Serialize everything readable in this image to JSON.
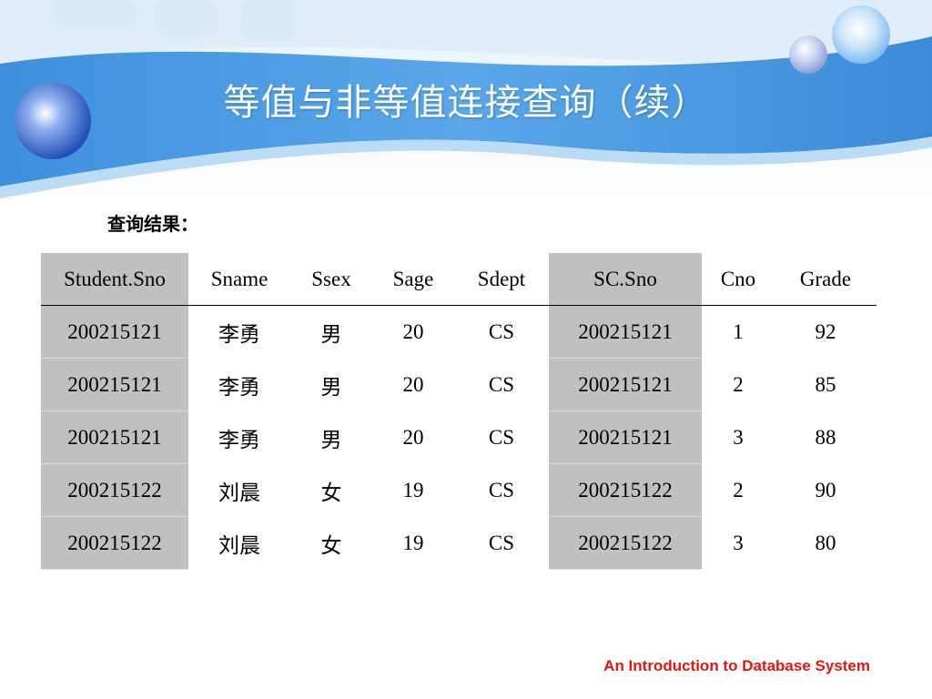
{
  "slide": {
    "title": "等值与非等值连接查询（续）",
    "label": "查询结果：",
    "footer": "An Introduction to Database System"
  },
  "table": {
    "headers": [
      "Student.Sno",
      "Sname",
      "Ssex",
      "Sage",
      "Sdept",
      "SC.Sno",
      "Cno",
      "Grade"
    ],
    "rows": [
      [
        "200215121",
        "李勇",
        "男",
        "20",
        "CS",
        "200215121",
        "1",
        "92"
      ],
      [
        "200215121",
        "李勇",
        "男",
        "20",
        "CS",
        "200215121",
        "2",
        "85"
      ],
      [
        "200215121",
        "李勇",
        "男",
        "20",
        "CS",
        "200215121",
        "3",
        "88"
      ],
      [
        "200215122",
        "刘晨",
        "女",
        "19",
        "CS",
        "200215122",
        "2",
        "90"
      ],
      [
        "200215122",
        "刘晨",
        "女",
        "19",
        "CS",
        "200215122",
        "3",
        "80"
      ]
    ]
  },
  "colors": {
    "banner_blue": "#4a9be0",
    "shaded_column": "#c0c0c0",
    "footer_red": "#e8140c"
  }
}
